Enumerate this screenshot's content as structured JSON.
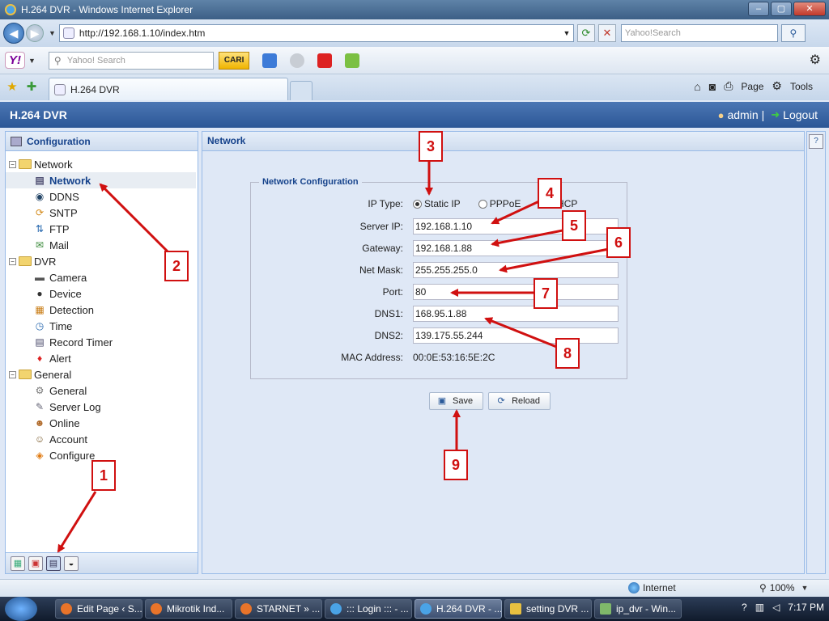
{
  "browser": {
    "window_title": "H.264 DVR - Windows Internet Explorer",
    "url": "http://192.168.1.10/index.htm",
    "search_placeholder": "Yahoo!Search",
    "yahoo_search_placeholder": "Yahoo! Search",
    "cari_label": "CARI",
    "tab_label": "H.264 DVR",
    "page_menu": "Page",
    "tools_menu": "Tools"
  },
  "app": {
    "title": "H.264 DVR",
    "user": "admin",
    "separator": "|",
    "logout": "Logout"
  },
  "sidebar": {
    "title": "Configuration",
    "groups": [
      {
        "label": "Network",
        "items": [
          "Network",
          "DDNS",
          "SNTP",
          "FTP",
          "Mail"
        ]
      },
      {
        "label": "DVR",
        "items": [
          "Camera",
          "Device",
          "Detection",
          "Time",
          "Record Timer",
          "Alert"
        ]
      },
      {
        "label": "General",
        "items": [
          "General",
          "Server Log",
          "Online",
          "Account",
          "Configure"
        ]
      }
    ],
    "selected": "Network"
  },
  "main": {
    "panel_title": "Network",
    "fieldset_legend": "Network Configuration",
    "ip_type_label": "IP Type:",
    "ip_type_options": [
      "Static IP",
      "PPPoE",
      "DHCP"
    ],
    "ip_type_selected": "Static IP",
    "fields": [
      {
        "label": "Server IP:",
        "value": "192.168.1.10"
      },
      {
        "label": "Gateway:",
        "value": "192.168.1.88"
      },
      {
        "label": "Net Mask:",
        "value": "255.255.255.0"
      },
      {
        "label": "Port:",
        "value": "80"
      },
      {
        "label": "DNS1:",
        "value": "168.95.1.88"
      },
      {
        "label": "DNS2:",
        "value": "139.175.55.244"
      }
    ],
    "mac_label": "MAC Address:",
    "mac_value": "00:0E:53:16:5E:2C",
    "save_label": "Save",
    "reload_label": "Reload"
  },
  "annotations": [
    "1",
    "2",
    "3",
    "4",
    "5",
    "6",
    "7",
    "8",
    "9"
  ],
  "statusbar": {
    "zone": "Internet",
    "zoom": "100%"
  },
  "taskbar": {
    "tasks": [
      "Edit Page ‹ S...",
      "Mikrotik Ind...",
      "STARNET » ...",
      "::: Login ::: - ...",
      "H.264 DVR - ...",
      "setting DVR ...",
      "ip_dvr - Win..."
    ],
    "active": "H.264 DVR - ...",
    "clock": "7:17 PM"
  },
  "colors": {
    "annotation_red": "#d01010",
    "header_blue": "#2c5796",
    "panel_title": "#15428b"
  }
}
